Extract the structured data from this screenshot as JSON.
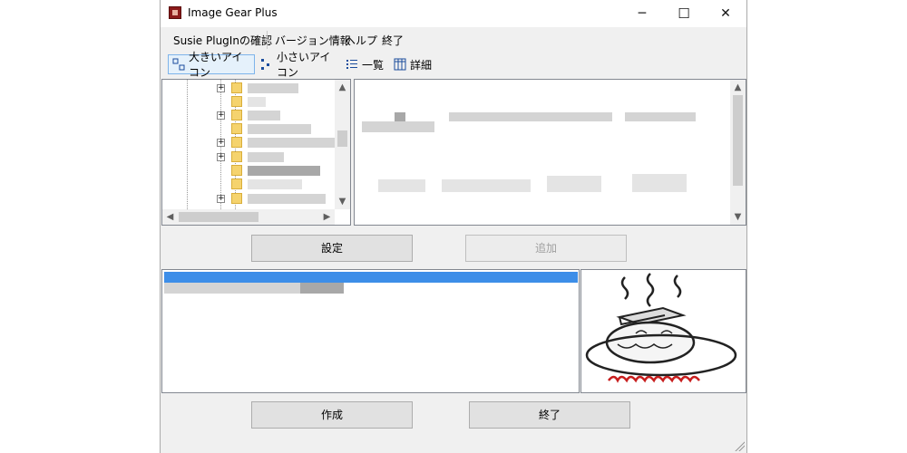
{
  "window": {
    "title": "Image Gear Plus",
    "controls": {
      "minimize": "─",
      "maximize": "☐",
      "close": "✕"
    }
  },
  "menu": {
    "items": [
      "Susie PlugInの確認",
      "バージョン情報",
      "ヘルプ",
      "終了"
    ]
  },
  "toolbar": {
    "buttons": [
      {
        "label": "大きいアイコン",
        "active": true
      },
      {
        "label": "小さいアイコン",
        "active": false
      },
      {
        "label": "一覧",
        "active": false
      },
      {
        "label": "詳細",
        "active": false
      }
    ]
  },
  "scroll_arrows": {
    "up": "▲",
    "down": "▼",
    "left": "◀",
    "right": "▶"
  },
  "buttons": {
    "settings": "設定",
    "add": "追加",
    "create": "作成",
    "exit": "終了"
  },
  "tree": {
    "expander": "+"
  },
  "colors": {
    "selection": "#3d8ee8",
    "folder": "#f5d36e",
    "window_bg": "#f0f0f0",
    "active_tool": "#e5f1fb"
  }
}
